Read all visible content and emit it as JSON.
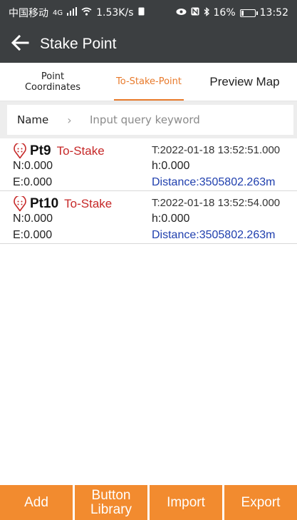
{
  "status_bar": {
    "carrier": "中国移动",
    "network": "4G",
    "speed": "1.53K/s",
    "battery_percent": "16%",
    "battery_level": 0.16,
    "time": "13:52"
  },
  "app_bar": {
    "title": "Stake Point"
  },
  "tabs": [
    {
      "label": "Point Coordinates",
      "active": false
    },
    {
      "label": "To-Stake-Point",
      "active": true
    },
    {
      "label": "Preview Map",
      "active": false
    }
  ],
  "search": {
    "field_label": "Name",
    "placeholder": "Input query keyword",
    "value": ""
  },
  "points": [
    {
      "name": "Pt9",
      "status": "To-Stake",
      "time": "T:2022-01-18 13:52:51.000",
      "n": "N:0.000",
      "h": "h:0.000",
      "e": "E:0.000",
      "distance": "Distance:3505802.263m"
    },
    {
      "name": "Pt10",
      "status": "To-Stake",
      "time": "T:2022-01-18 13:52:54.000",
      "n": "N:0.000",
      "h": "h:0.000",
      "e": "E:0.000",
      "distance": "Distance:3505802.263m"
    }
  ],
  "bottom_buttons": {
    "add": "Add",
    "button_library": "Button Library",
    "import": "Import",
    "export": "Export"
  },
  "colors": {
    "accent": "#e87a2b",
    "button": "#f28b2f",
    "status_red": "#c62828",
    "distance_blue": "#1f3fae",
    "bar": "#3c3f41"
  }
}
